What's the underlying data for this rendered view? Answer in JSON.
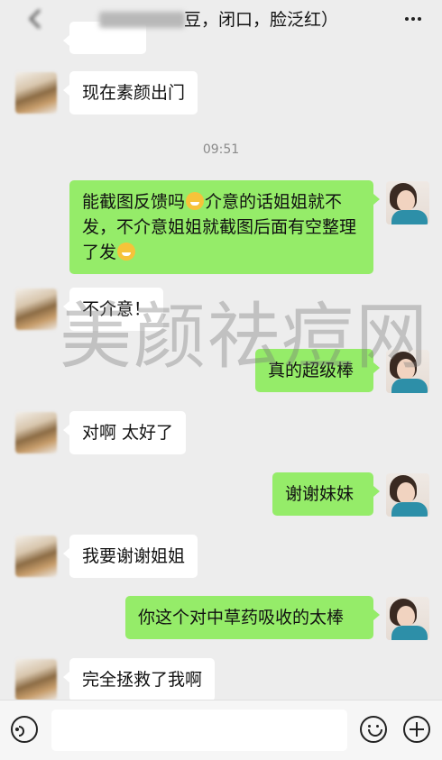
{
  "header": {
    "title_visible": "豆，闭口，脸泛红）"
  },
  "messages": [
    {
      "side": "left",
      "text": "现在素颜出门"
    },
    {
      "type": "time",
      "text": "09:51"
    },
    {
      "side": "right",
      "text_part1": "能截图反馈吗",
      "text_part2": "介意的话姐姐就不发，不介意姐姐就截图后面有空整理了发"
    },
    {
      "side": "left",
      "text": "不介意！"
    },
    {
      "side": "right",
      "text": "真的超级棒"
    },
    {
      "side": "left",
      "text": "对啊 太好了"
    },
    {
      "side": "right",
      "text": "谢谢妹妹"
    },
    {
      "side": "left",
      "text": "我要谢谢姐姐"
    },
    {
      "side": "right",
      "text": "你这个对中草药吸收的太棒"
    },
    {
      "side": "left",
      "text": "完全拯救了我啊"
    }
  ],
  "watermark": "美颜祛痘网",
  "colors": {
    "background": "#ededed",
    "bubble_sent": "#95ec69",
    "bubble_received": "#ffffff"
  },
  "icons": [
    "back-icon",
    "more-icon",
    "voice-icon",
    "emoji-icon",
    "plus-icon"
  ]
}
